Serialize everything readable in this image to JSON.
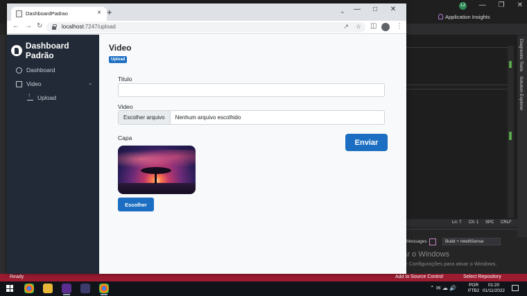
{
  "vs": {
    "app_insights": "Application Insights",
    "user_initials": "LJ",
    "side_tabs": [
      "Diagnostic Tools",
      "Solution Explorer"
    ],
    "editor_status": [
      "Ln: 7",
      "Ch: 1",
      "SPC",
      "CRLF"
    ],
    "output_label": "Messages",
    "build_filter": "Build + IntelliSense",
    "status_ready": "Ready",
    "add_source_control": "Add to Source Control",
    "select_repository": "Select Repository",
    "activate_title": "Ativar o Windows",
    "activate_sub": "Acesse Configurações para ativar o Windows."
  },
  "taskbar": {
    "lang_1": "POR",
    "lang_2": "PTB2",
    "time": "01:20",
    "date": "01/11/2022"
  },
  "browser": {
    "tab_title": "DashboardPadrao",
    "url_host": "localhost",
    "url_rest": ":7247/upload"
  },
  "sidebar": {
    "brand": "Dashboard Padrão",
    "items": [
      {
        "label": "Dashboard"
      },
      {
        "label": "Video"
      },
      {
        "label": "Upload"
      }
    ]
  },
  "main": {
    "title": "Video",
    "badge": "Upload",
    "titulo_label": "Titulo",
    "video_label": "Video",
    "file_button": "Escolher arquivo",
    "file_none": "Nenhum arquivo escolhido",
    "capa_label": "Capa",
    "send_button": "Enviar",
    "choose_button": "Escolher"
  }
}
